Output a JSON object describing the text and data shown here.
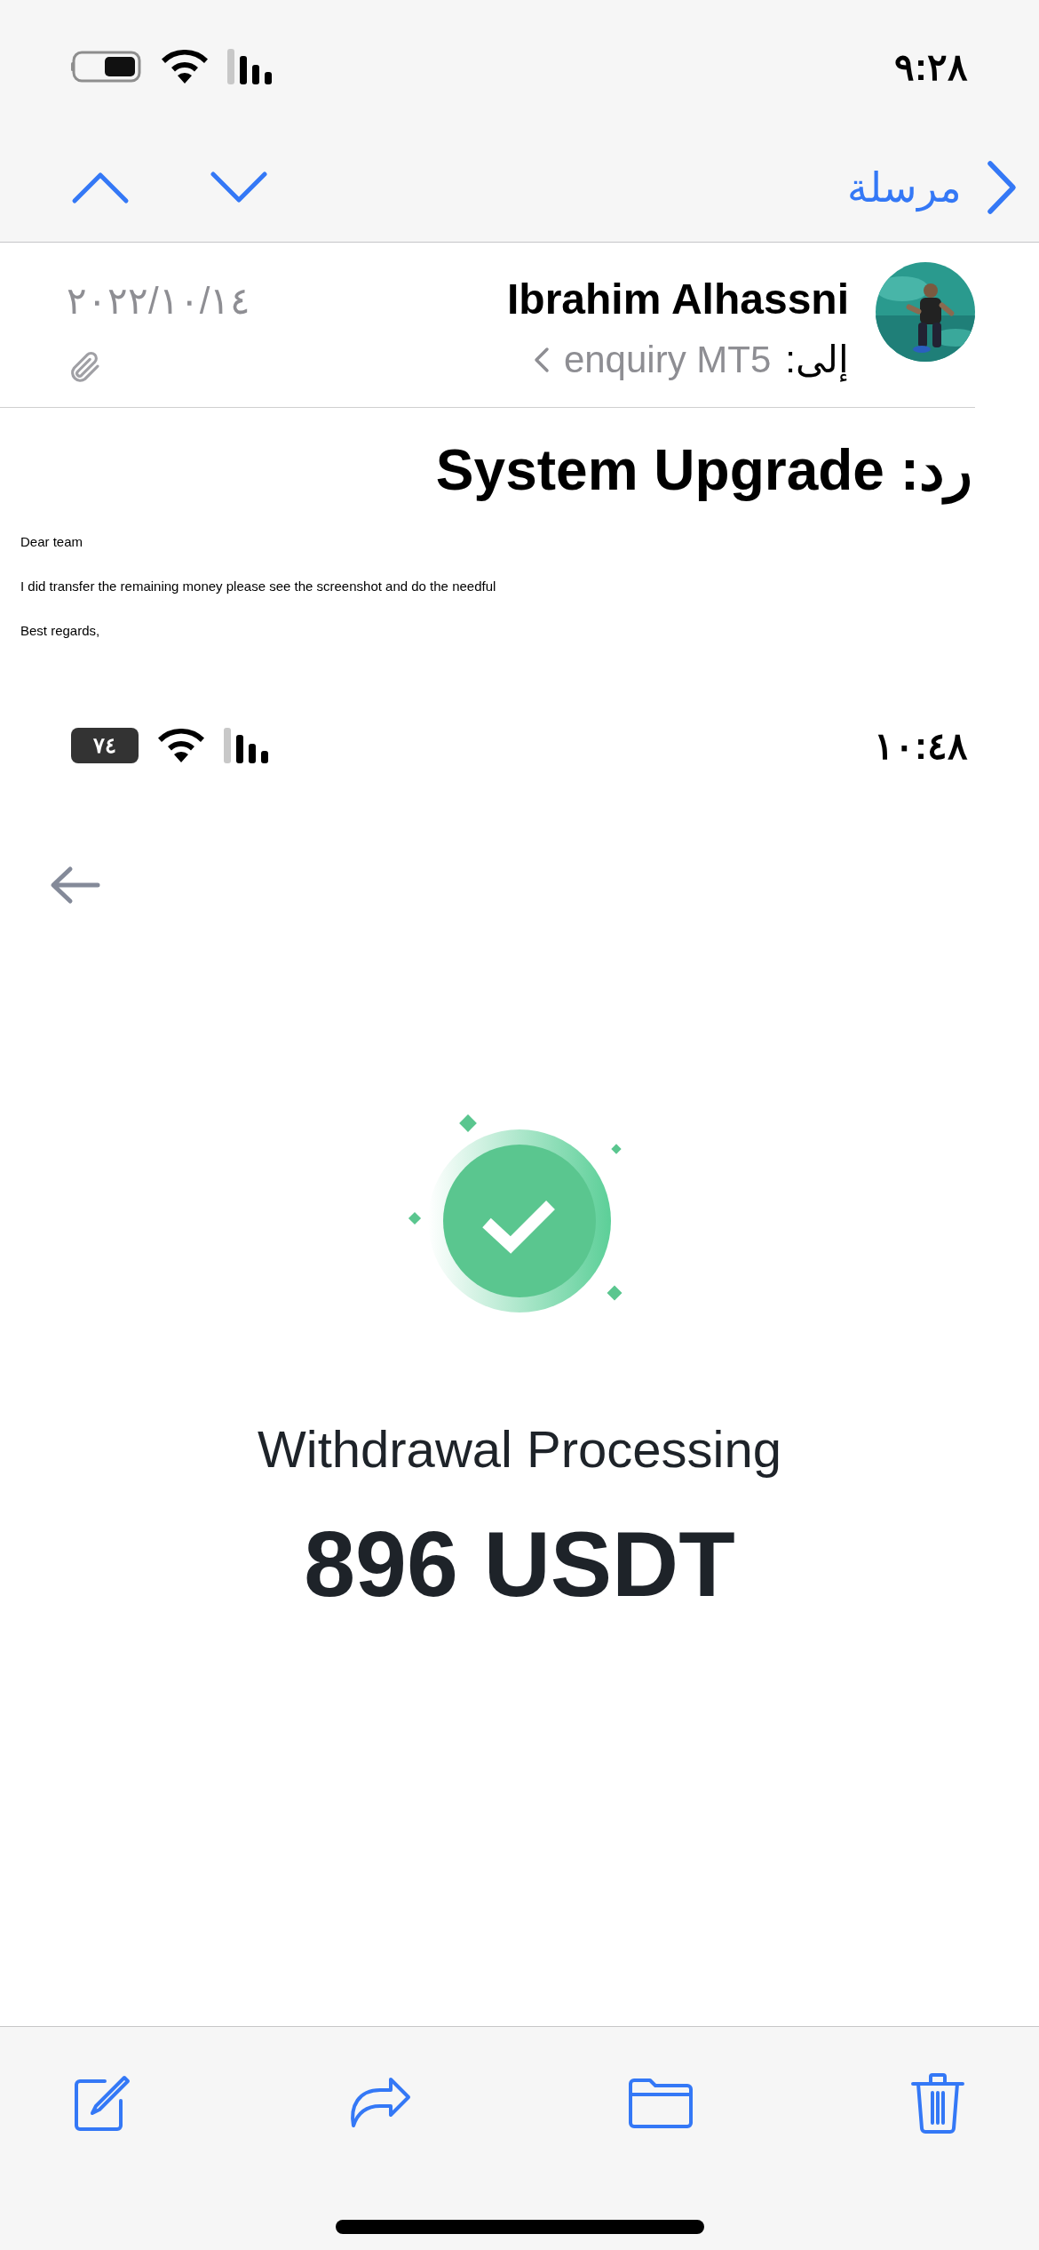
{
  "status_bar": {
    "time": "٩:٢٨"
  },
  "nav": {
    "back_label": "مرسلة"
  },
  "message": {
    "sender": "Ibrahim Alhassni",
    "to_label": "إلى:",
    "recipient": "enquiry MT5",
    "date": "٢٠٢٢/١٠/١٤",
    "has_attachment": true,
    "subject": "رد: System Upgrade",
    "body": [
      "Dear team",
      "I did transfer the remaining money please see the screenshot and do the needful",
      "Best regards,"
    ]
  },
  "attached_screenshot": {
    "status_bar": {
      "time": "١٠:٤٨",
      "battery": "٧٤"
    },
    "title": "Withdrawal Processing",
    "amount": "896 USDT"
  }
}
